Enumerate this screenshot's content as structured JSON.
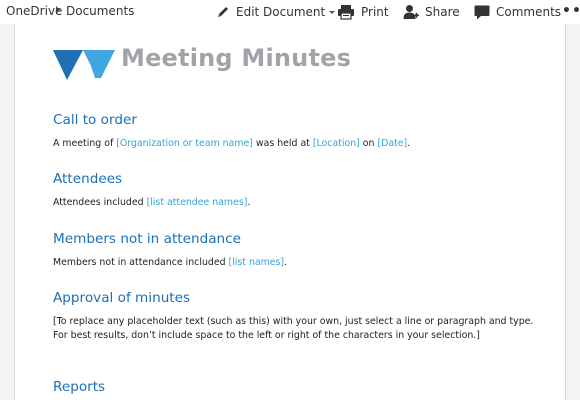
{
  "breadcrumb": {
    "root": "OneDrive",
    "current": "Documents"
  },
  "commands": {
    "edit": "Edit Document",
    "print": "Print",
    "share": "Share",
    "comments": "Comments",
    "more": "•••"
  },
  "icons": {
    "edit": "pencil-icon",
    "print": "printer-icon",
    "share": "person-add-icon",
    "comments": "speech-bubble-icon"
  },
  "colors": {
    "heading": "#1e6fb4",
    "placeholder": "#33a3d9",
    "title": "#a0a4a8",
    "logo_dark": "#1e6fb4",
    "logo_light": "#41a6e0"
  },
  "document": {
    "title": "Meeting Minutes",
    "call_to_order": {
      "heading": "Call to order",
      "t1": "A meeting of ",
      "ph_org": "[Organization or team name]",
      "t2": " was held at ",
      "ph_location": "[Location]",
      "t3": " on ",
      "ph_date": "[Date]",
      "t4": "."
    },
    "attendees": {
      "heading": "Attendees",
      "t1": "Attendees included ",
      "ph": "[list attendee names]",
      "t2": "."
    },
    "not_attending": {
      "heading": "Members not in attendance",
      "t1": "Members not in attendance included ",
      "ph": "[list names]",
      "t2": "."
    },
    "approval": {
      "heading": "Approval of minutes",
      "body": "[To replace any placeholder text (such as this) with your own, just select a line or paragraph and type. For best results, don’t include space to the left or right of the characters in your selection.]"
    },
    "reports": {
      "heading": "Reports"
    }
  }
}
